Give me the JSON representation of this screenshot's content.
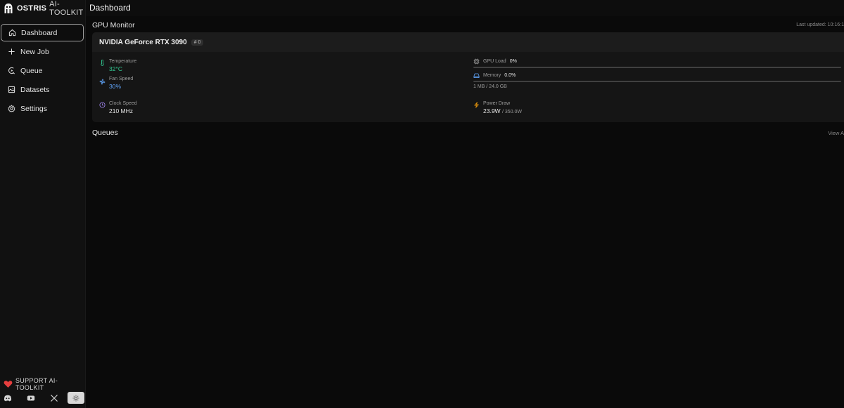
{
  "brand": {
    "name": "OSTRIS",
    "sub": "AI-TOOLKIT"
  },
  "header": {
    "title": "Dashboard"
  },
  "sidebar": {
    "items": [
      {
        "label": "Dashboard",
        "icon": "home-icon",
        "active": true
      },
      {
        "label": "New Job",
        "icon": "plus-icon"
      },
      {
        "label": "Queue",
        "icon": "queue-icon"
      },
      {
        "label": "Datasets",
        "icon": "images-icon"
      },
      {
        "label": "Settings",
        "icon": "gear-icon"
      }
    ],
    "support_label": "SUPPORT AI-TOOLKIT",
    "socials": [
      "discord-icon",
      "youtube-icon",
      "x-icon"
    ],
    "theme_toggle": "sun-icon"
  },
  "gpu_monitor": {
    "title": "GPU Monitor",
    "last_updated": "Last updated: 10:16:1",
    "gpu": {
      "name": "NVIDIA GeForce RTX 3090",
      "index": "# 0",
      "temperature": {
        "label": "Temperature",
        "value": "32°C"
      },
      "fan_speed": {
        "label": "Fan Speed",
        "value": "30%"
      },
      "clock_speed": {
        "label": "Clock Speed",
        "value": "210 MHz"
      },
      "gpu_load": {
        "label": "GPU Load",
        "value": "0%",
        "fraction": 0
      },
      "memory": {
        "label": "Memory",
        "value": "0.0%",
        "fraction": 0,
        "usage": "1 MB / 24.0 GB"
      },
      "power_draw": {
        "label": "Power Draw",
        "value": "23.9W",
        "limit": "/ 350.0W"
      }
    }
  },
  "queues": {
    "title": "Queues",
    "view_all": "View A"
  },
  "colors": {
    "accent_green": "#34d399",
    "accent_blue": "#60a5fa",
    "heart": "#e53e3e"
  }
}
